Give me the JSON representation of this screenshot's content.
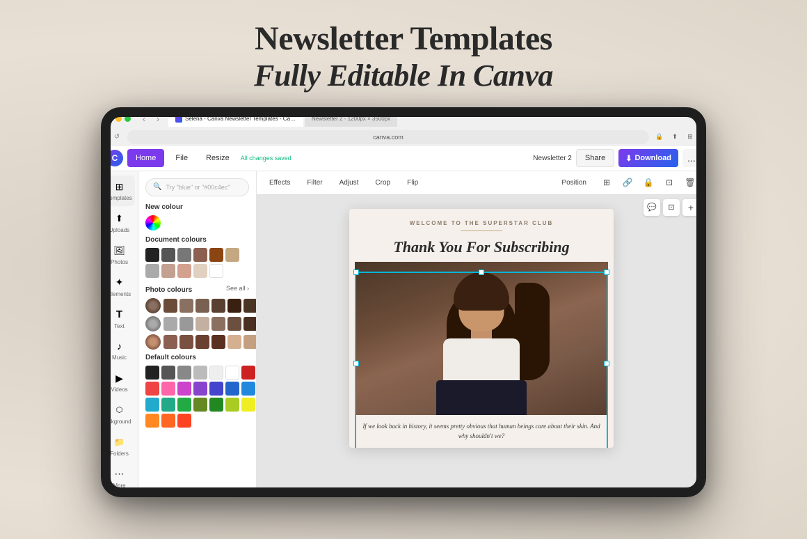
{
  "headline": {
    "line1": "Newsletter Templates",
    "line2": "Fully Editable In Canva"
  },
  "browser": {
    "tab1_title": "Selena - Canva Newsletter Templates - Canva",
    "tab2_title": "Newsletter 2 - 1200px × 3500px",
    "address": "canva.com"
  },
  "toolbar": {
    "home_label": "Home",
    "file_label": "File",
    "resize_label": "Resize",
    "saved_label": "All changes saved",
    "doc_name": "Newsletter 2",
    "share_label": "Share",
    "download_label": "Download",
    "more_label": "..."
  },
  "canvas_toolbar": {
    "effects_label": "Effects",
    "filter_label": "Filter",
    "adjust_label": "Adjust",
    "crop_label": "Crop",
    "flip_label": "Flip",
    "position_label": "Position"
  },
  "sidebar": {
    "items": [
      {
        "label": "Templates",
        "icon": "⊞"
      },
      {
        "label": "Uploads",
        "icon": "⬆"
      },
      {
        "label": "Photos",
        "icon": "🖼"
      },
      {
        "label": "Elements",
        "icon": "✦"
      },
      {
        "label": "Text",
        "icon": "T"
      },
      {
        "label": "Music",
        "icon": "♪"
      },
      {
        "label": "Videos",
        "icon": "▶"
      },
      {
        "label": "Bkground",
        "icon": "⬡"
      },
      {
        "label": "Folders",
        "icon": "📁"
      },
      {
        "label": "More",
        "icon": "⋯"
      }
    ]
  },
  "color_panel": {
    "search_placeholder": "Try \"blue\" or \"#00c4ec\"",
    "new_colour_label": "New colour",
    "document_colours_label": "Document colours",
    "photo_colours_label": "Photo colours",
    "see_all_label": "See all ›",
    "default_colours_label": "Default colours",
    "document_swatches": [
      "#222222",
      "#555555",
      "#777777",
      "#8B6050",
      "#8B4513",
      "#C4A882",
      "#AAAAAA",
      "#C4A090",
      "#D4A090",
      "#E0D0C0",
      "#FFFFFF"
    ],
    "photo_rows": [
      {
        "thumb_color": "#5a4535",
        "swatches": [
          "#6b4c38",
          "#8a7060",
          "#7a6050",
          "#5a4030",
          "#3a2010",
          "#4a3525",
          "#c4a882",
          "#d0b898"
        ]
      },
      {
        "thumb_color": "#888888",
        "swatches": [
          "#aaaaaa",
          "#999999",
          "#c4b0a0",
          "#8b7060",
          "#6b5040",
          "#4a3020",
          "#3a2010",
          "#2a1505"
        ]
      },
      {
        "thumb_color": "#7a5a48",
        "swatches": [
          "#8b6050",
          "#7a5040",
          "#6a4030",
          "#5a3020",
          "#4a2010",
          "#d4b090",
          "#c4a080",
          "#b49070"
        ]
      }
    ],
    "default_swatches_row1": [
      "#222222",
      "#555555",
      "#888888",
      "#bbbbbb",
      "#eeeeee",
      "#ffffff"
    ],
    "default_swatches_colors": [
      "#222222",
      "#555555",
      "#888888",
      "#bbbbbb",
      "#eeeeee",
      "#ffffff",
      "#cc2222",
      "#ee4444",
      "#ff66aa",
      "#cc44cc",
      "#8844cc",
      "#4444cc",
      "#2266cc",
      "#2288dd",
      "#22aacc",
      "#22aa88",
      "#22aa44",
      "#668822",
      "#228822",
      "#aacc22",
      "#eeee22",
      "#ff8822",
      "#ff6622",
      "#ff4422"
    ]
  },
  "newsletter": {
    "welcome_text": "WELCOME TO THE SUPERSTAR CLUB",
    "title": "Thank You For Subscribing",
    "body_text": "If we look back in history, it seems pretty obvious that human beings care about their skin. And why shouldn't we?"
  }
}
